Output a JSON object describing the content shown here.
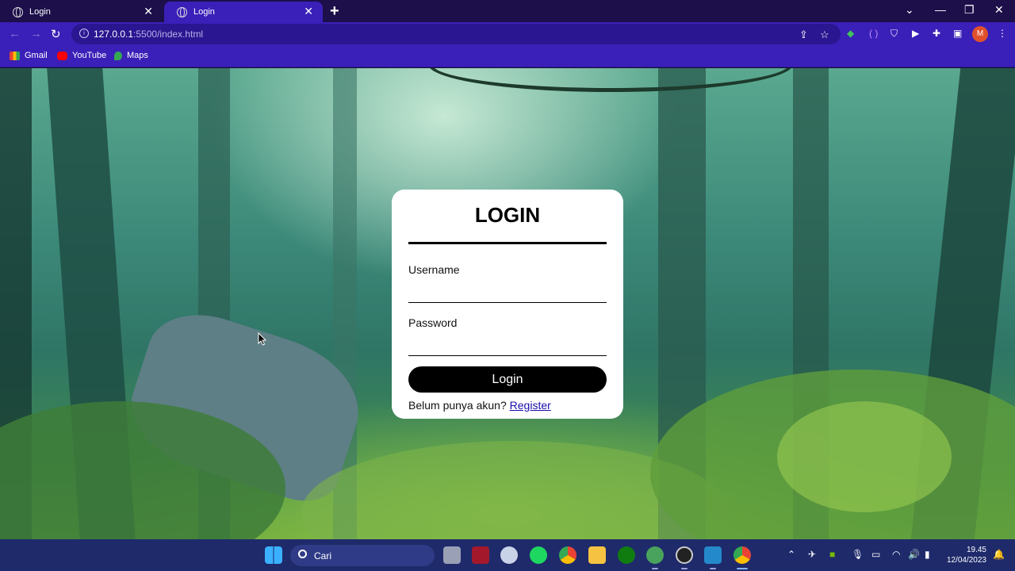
{
  "browser": {
    "tabs": [
      {
        "title": "Login",
        "active": false
      },
      {
        "title": "Login",
        "active": true
      }
    ],
    "url_host": "127.0.0.1",
    "url_path": ":5500/index.html",
    "profile_initial": "M",
    "bookmarks": [
      {
        "label": "Gmail",
        "icon": "gmail-icon"
      },
      {
        "label": "YouTube",
        "icon": "youtube-icon"
      },
      {
        "label": "Maps",
        "icon": "maps-icon"
      }
    ]
  },
  "login": {
    "title": "LOGIN",
    "username_label": "Username",
    "username_value": "",
    "password_label": "Password",
    "password_value": "",
    "submit_label": "Login",
    "register_prompt": "Belum punya akun?",
    "register_link": "Register"
  },
  "taskbar": {
    "search_placeholder": "Cari",
    "time": "19.45",
    "date": "12/04/2023"
  },
  "colors": {
    "chrome_dark": "#1c0f4a",
    "chrome_accent": "#3a20b8",
    "taskbar": "#1f2a6b",
    "card": "#ffffff",
    "button": "#000000",
    "link": "#1a0dab"
  }
}
